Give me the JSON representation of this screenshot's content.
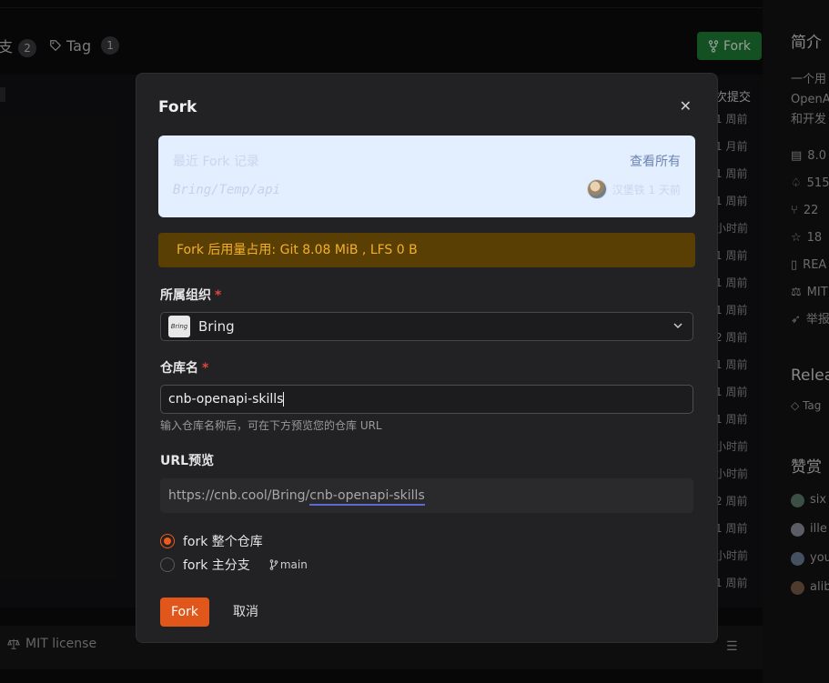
{
  "background": {
    "tabs": [
      {
        "label": "支",
        "count": "2"
      },
      {
        "label": "Tag",
        "count": "1"
      }
    ],
    "fork_button": "Fork",
    "commit_header": "次提交",
    "commit_times": [
      "1 周前",
      "1 月前",
      "1 周前",
      "1 周前",
      "小时前",
      "1 周前",
      "1 周前",
      "1 周前",
      "2 周前",
      "1 周前",
      "1 周前",
      "1 周前",
      "小时前",
      "小时前",
      "2 周前",
      "1 周前",
      "小时前",
      "1 周前"
    ],
    "license": "MIT license",
    "sidebar": {
      "title": "简介",
      "desc_lines": [
        "一个用",
        "OpenA",
        "和开发"
      ],
      "meta": [
        "8.0",
        "515",
        "22",
        "18",
        "REA",
        "MIT",
        "举报"
      ],
      "releases": "Relea",
      "tag_line": "Tag",
      "fans_title": "赞赏",
      "users": [
        "six",
        "ille",
        "you",
        "alib"
      ]
    }
  },
  "modal": {
    "title": "Fork",
    "close_icon": "close-icon",
    "recent": {
      "title": "最近 Fork 记录",
      "view_all": "查看所有",
      "path": "Bring/Temp/api",
      "by": "汉堡铁 1 天前"
    },
    "usage_notice": "Fork 后用量占用: Git 8.08 MiB , LFS 0 B",
    "org_label": "所属组织",
    "required_mark": "*",
    "org_value": "Bring",
    "org_logo_text": "Bring",
    "repo_label": "仓库名",
    "repo_value": "cnb-openapi-skills",
    "repo_hint": "输入仓库名称后，可在下方预览您的仓库 URL",
    "url_label": "URL预览",
    "url_prefix": "https://cnb.cool/Bring/",
    "url_slug": "cnb-openapi-skills",
    "options": [
      {
        "label": "fork 整个仓库",
        "selected": true
      },
      {
        "label": "fork 主分支",
        "selected": false,
        "branch": "main"
      }
    ],
    "submit": "Fork",
    "cancel": "取消"
  },
  "colors": {
    "accent": "#e0561b",
    "fork_green": "#1e7b35",
    "warning_bg": "#5a3f05",
    "warning_text": "#f4b028",
    "info_bg": "#e3eeff"
  }
}
